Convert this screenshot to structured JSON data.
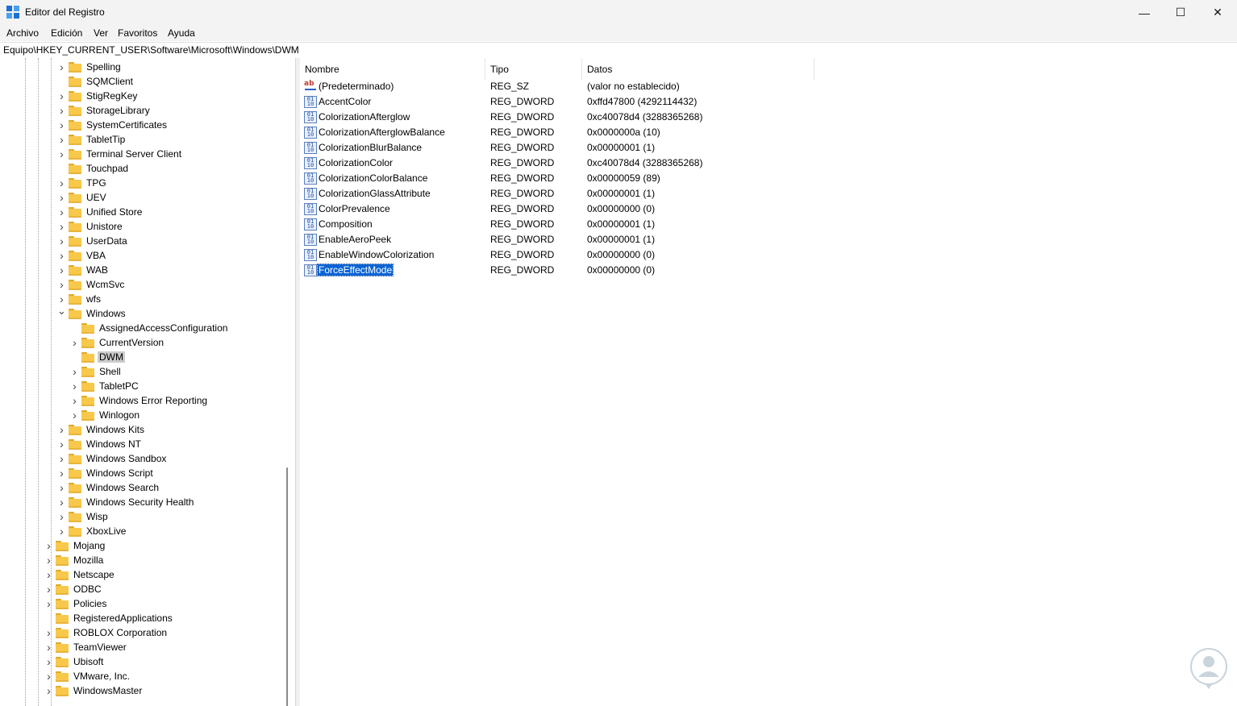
{
  "window": {
    "title": "Editor del Registro",
    "minimize_glyph": "—",
    "maximize_glyph": "☐",
    "close_glyph": "✕"
  },
  "menu": [
    "Archivo",
    "Edición",
    "Ver",
    "Favoritos",
    "Ayuda"
  ],
  "address": "Equipo\\HKEY_CURRENT_USER\\Software\\Microsoft\\Windows\\DWM",
  "tree": [
    {
      "label": "Spelling",
      "level": 2,
      "expandable": true
    },
    {
      "label": "SQMClient",
      "level": 2,
      "expandable": false
    },
    {
      "label": "StigRegKey",
      "level": 2,
      "expandable": true
    },
    {
      "label": "StorageLibrary",
      "level": 2,
      "expandable": true
    },
    {
      "label": "SystemCertificates",
      "level": 2,
      "expandable": true
    },
    {
      "label": "TabletTip",
      "level": 2,
      "expandable": true
    },
    {
      "label": "Terminal Server Client",
      "level": 2,
      "expandable": true
    },
    {
      "label": "Touchpad",
      "level": 2,
      "expandable": false
    },
    {
      "label": "TPG",
      "level": 2,
      "expandable": true
    },
    {
      "label": "UEV",
      "level": 2,
      "expandable": true
    },
    {
      "label": "Unified Store",
      "level": 2,
      "expandable": true
    },
    {
      "label": "Unistore",
      "level": 2,
      "expandable": true
    },
    {
      "label": "UserData",
      "level": 2,
      "expandable": true
    },
    {
      "label": "VBA",
      "level": 2,
      "expandable": true
    },
    {
      "label": "WAB",
      "level": 2,
      "expandable": true
    },
    {
      "label": "WcmSvc",
      "level": 2,
      "expandable": true
    },
    {
      "label": "wfs",
      "level": 2,
      "expandable": true
    },
    {
      "label": "Windows",
      "level": 2,
      "expandable": true,
      "expanded": true
    },
    {
      "label": "AssignedAccessConfiguration",
      "level": 3,
      "expandable": false
    },
    {
      "label": "CurrentVersion",
      "level": 3,
      "expandable": true
    },
    {
      "label": "DWM",
      "level": 3,
      "expandable": false,
      "selected": true
    },
    {
      "label": "Shell",
      "level": 3,
      "expandable": true
    },
    {
      "label": "TabletPC",
      "level": 3,
      "expandable": true
    },
    {
      "label": "Windows Error Reporting",
      "level": 3,
      "expandable": true
    },
    {
      "label": "Winlogon",
      "level": 3,
      "expandable": true
    },
    {
      "label": "Windows Kits",
      "level": 2,
      "expandable": true
    },
    {
      "label": "Windows NT",
      "level": 2,
      "expandable": true
    },
    {
      "label": "Windows Sandbox",
      "level": 2,
      "expandable": true
    },
    {
      "label": "Windows Script",
      "level": 2,
      "expandable": true
    },
    {
      "label": "Windows Search",
      "level": 2,
      "expandable": true
    },
    {
      "label": "Windows Security Health",
      "level": 2,
      "expandable": true
    },
    {
      "label": "Wisp",
      "level": 2,
      "expandable": true
    },
    {
      "label": "XboxLive",
      "level": 2,
      "expandable": true
    },
    {
      "label": "Mojang",
      "level": 1,
      "expandable": true
    },
    {
      "label": "Mozilla",
      "level": 1,
      "expandable": true
    },
    {
      "label": "Netscape",
      "level": 1,
      "expandable": true
    },
    {
      "label": "ODBC",
      "level": 1,
      "expandable": true
    },
    {
      "label": "Policies",
      "level": 1,
      "expandable": true
    },
    {
      "label": "RegisteredApplications",
      "level": 1,
      "expandable": false
    },
    {
      "label": "ROBLOX Corporation",
      "level": 1,
      "expandable": true
    },
    {
      "label": "TeamViewer",
      "level": 1,
      "expandable": true
    },
    {
      "label": "Ubisoft",
      "level": 1,
      "expandable": true
    },
    {
      "label": "VMware, Inc.",
      "level": 1,
      "expandable": true
    },
    {
      "label": "WindowsMaster",
      "level": 1,
      "expandable": true
    }
  ],
  "columns": {
    "name": "Nombre",
    "type": "Tipo",
    "data": "Datos"
  },
  "values": [
    {
      "name": "(Predeterminado)",
      "type": "REG_SZ",
      "data": "(valor no establecido)",
      "icon": "string-value-icon"
    },
    {
      "name": "AccentColor",
      "type": "REG_DWORD",
      "data": "0xffd47800 (4292114432)",
      "icon": "binary-value-icon"
    },
    {
      "name": "ColorizationAfterglow",
      "type": "REG_DWORD",
      "data": "0xc40078d4 (3288365268)",
      "icon": "binary-value-icon"
    },
    {
      "name": "ColorizationAfterglowBalance",
      "type": "REG_DWORD",
      "data": "0x0000000a (10)",
      "icon": "binary-value-icon"
    },
    {
      "name": "ColorizationBlurBalance",
      "type": "REG_DWORD",
      "data": "0x00000001 (1)",
      "icon": "binary-value-icon"
    },
    {
      "name": "ColorizationColor",
      "type": "REG_DWORD",
      "data": "0xc40078d4 (3288365268)",
      "icon": "binary-value-icon"
    },
    {
      "name": "ColorizationColorBalance",
      "type": "REG_DWORD",
      "data": "0x00000059 (89)",
      "icon": "binary-value-icon"
    },
    {
      "name": "ColorizationGlassAttribute",
      "type": "REG_DWORD",
      "data": "0x00000001 (1)",
      "icon": "binary-value-icon"
    },
    {
      "name": "ColorPrevalence",
      "type": "REG_DWORD",
      "data": "0x00000000 (0)",
      "icon": "binary-value-icon"
    },
    {
      "name": "Composition",
      "type": "REG_DWORD",
      "data": "0x00000001 (1)",
      "icon": "binary-value-icon"
    },
    {
      "name": "EnableAeroPeek",
      "type": "REG_DWORD",
      "data": "0x00000001 (1)",
      "icon": "binary-value-icon"
    },
    {
      "name": "EnableWindowColorization",
      "type": "REG_DWORD",
      "data": "0x00000000 (0)",
      "icon": "binary-value-icon"
    },
    {
      "name": "ForceEffectMode",
      "type": "REG_DWORD",
      "data": "0x00000000 (0)",
      "icon": "binary-value-icon",
      "selected": true
    }
  ],
  "colors": {
    "selection_blue": "#0a64d4",
    "tree_selected": "#cccccc",
    "folder_yellow": "#f8c84a",
    "titlebar_bg": "#f3f3f3"
  }
}
